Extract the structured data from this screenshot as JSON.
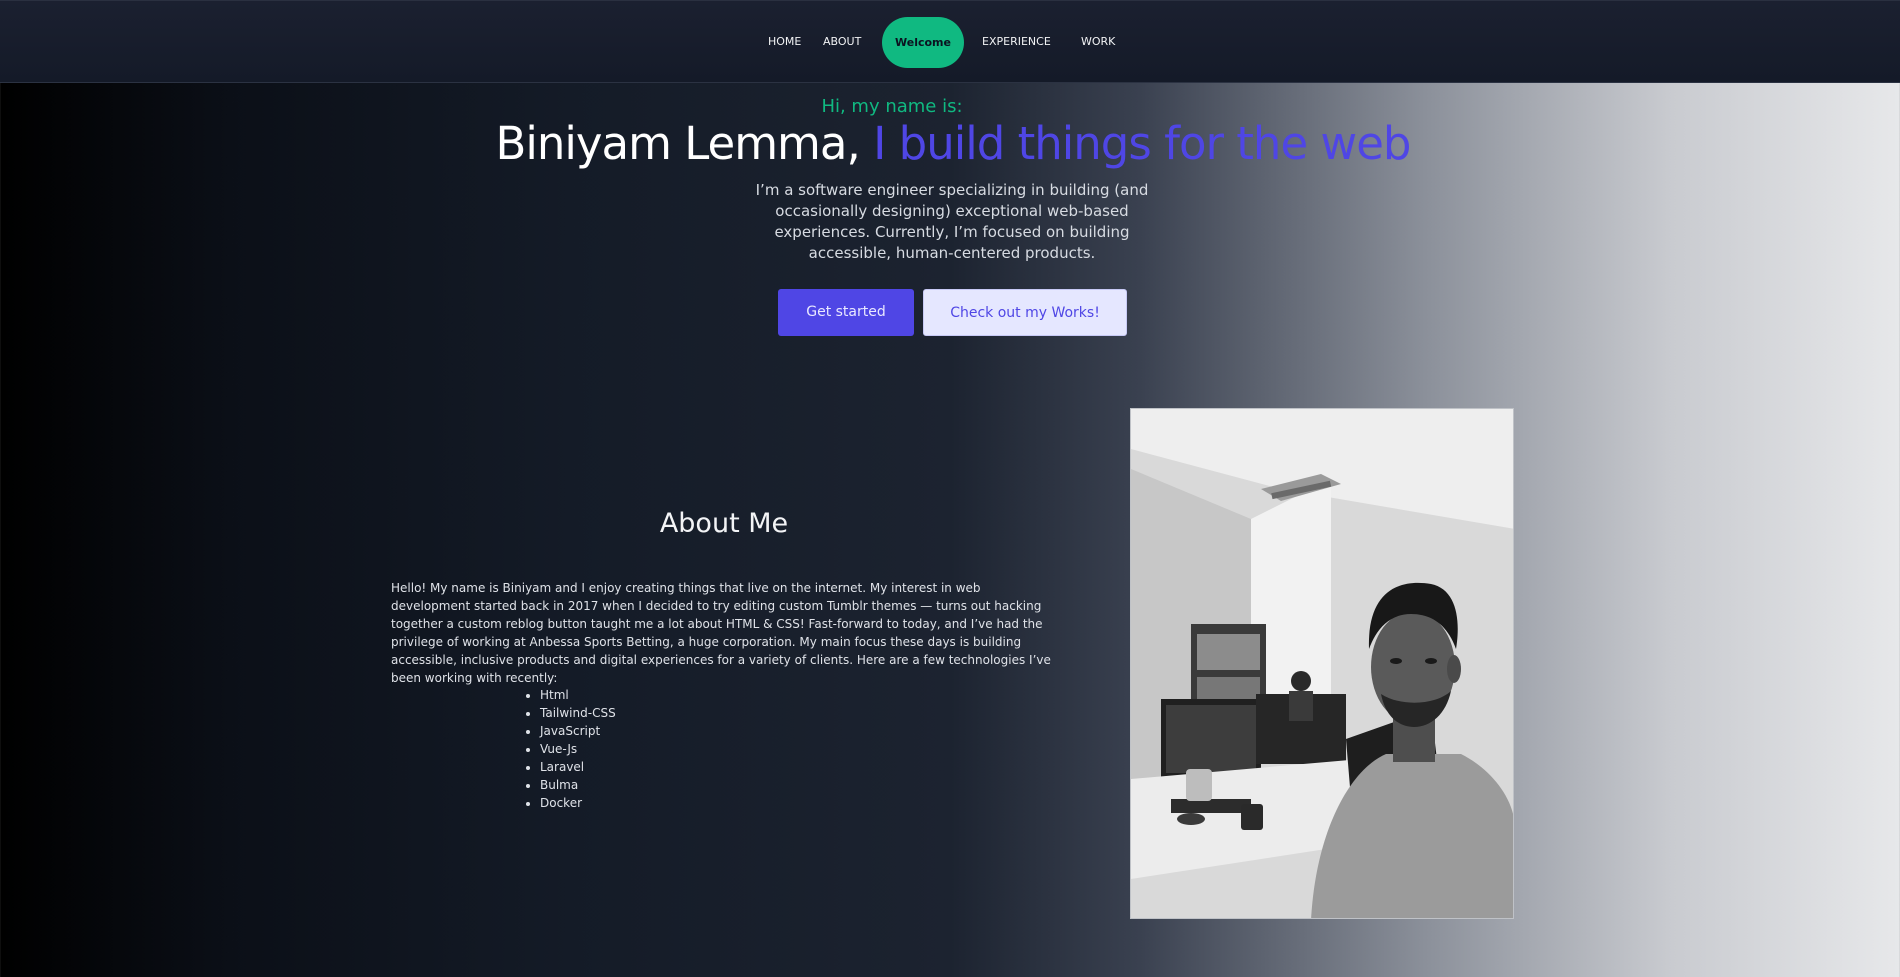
{
  "nav": {
    "items": [
      "HOME",
      "ABOUT",
      "Welcome",
      "EXPERIENCE",
      "WORK"
    ]
  },
  "hero": {
    "intro": "Hi, my name is:",
    "name": "Biniyam Lemma,",
    "tagline": "I build things for the web",
    "description": "I’m a software engineer specializing in building (and occasionally designing) exceptional web-based experiences. Currently, I’m focused on building accessible, human-centered products.",
    "primary_button": "Get started",
    "secondary_button": "Check out my Works!"
  },
  "about": {
    "title": "About Me",
    "text": "Hello! My name is Biniyam and I enjoy creating things that live on the internet. My interest in web development started back in 2017 when I decided to try editing custom Tumblr themes — turns out hacking together a custom reblog button taught me a lot about HTML & CSS! Fast-forward to today, and I’ve had the privilege of working at Anbessa Sports Betting, a huge corporation. My main focus these days is building accessible, inclusive products and digital experiences for a variety of clients. Here are a few technologies I’ve been working with recently:",
    "technologies": [
      "Html",
      "Tailwind-CSS",
      "JavaScript",
      "Vue-Js",
      "Laravel",
      "Bulma",
      "Docker"
    ]
  },
  "colors": {
    "accent_green": "#10b981",
    "accent_indigo": "#4f46e5",
    "nav_bg": "#141a28"
  }
}
